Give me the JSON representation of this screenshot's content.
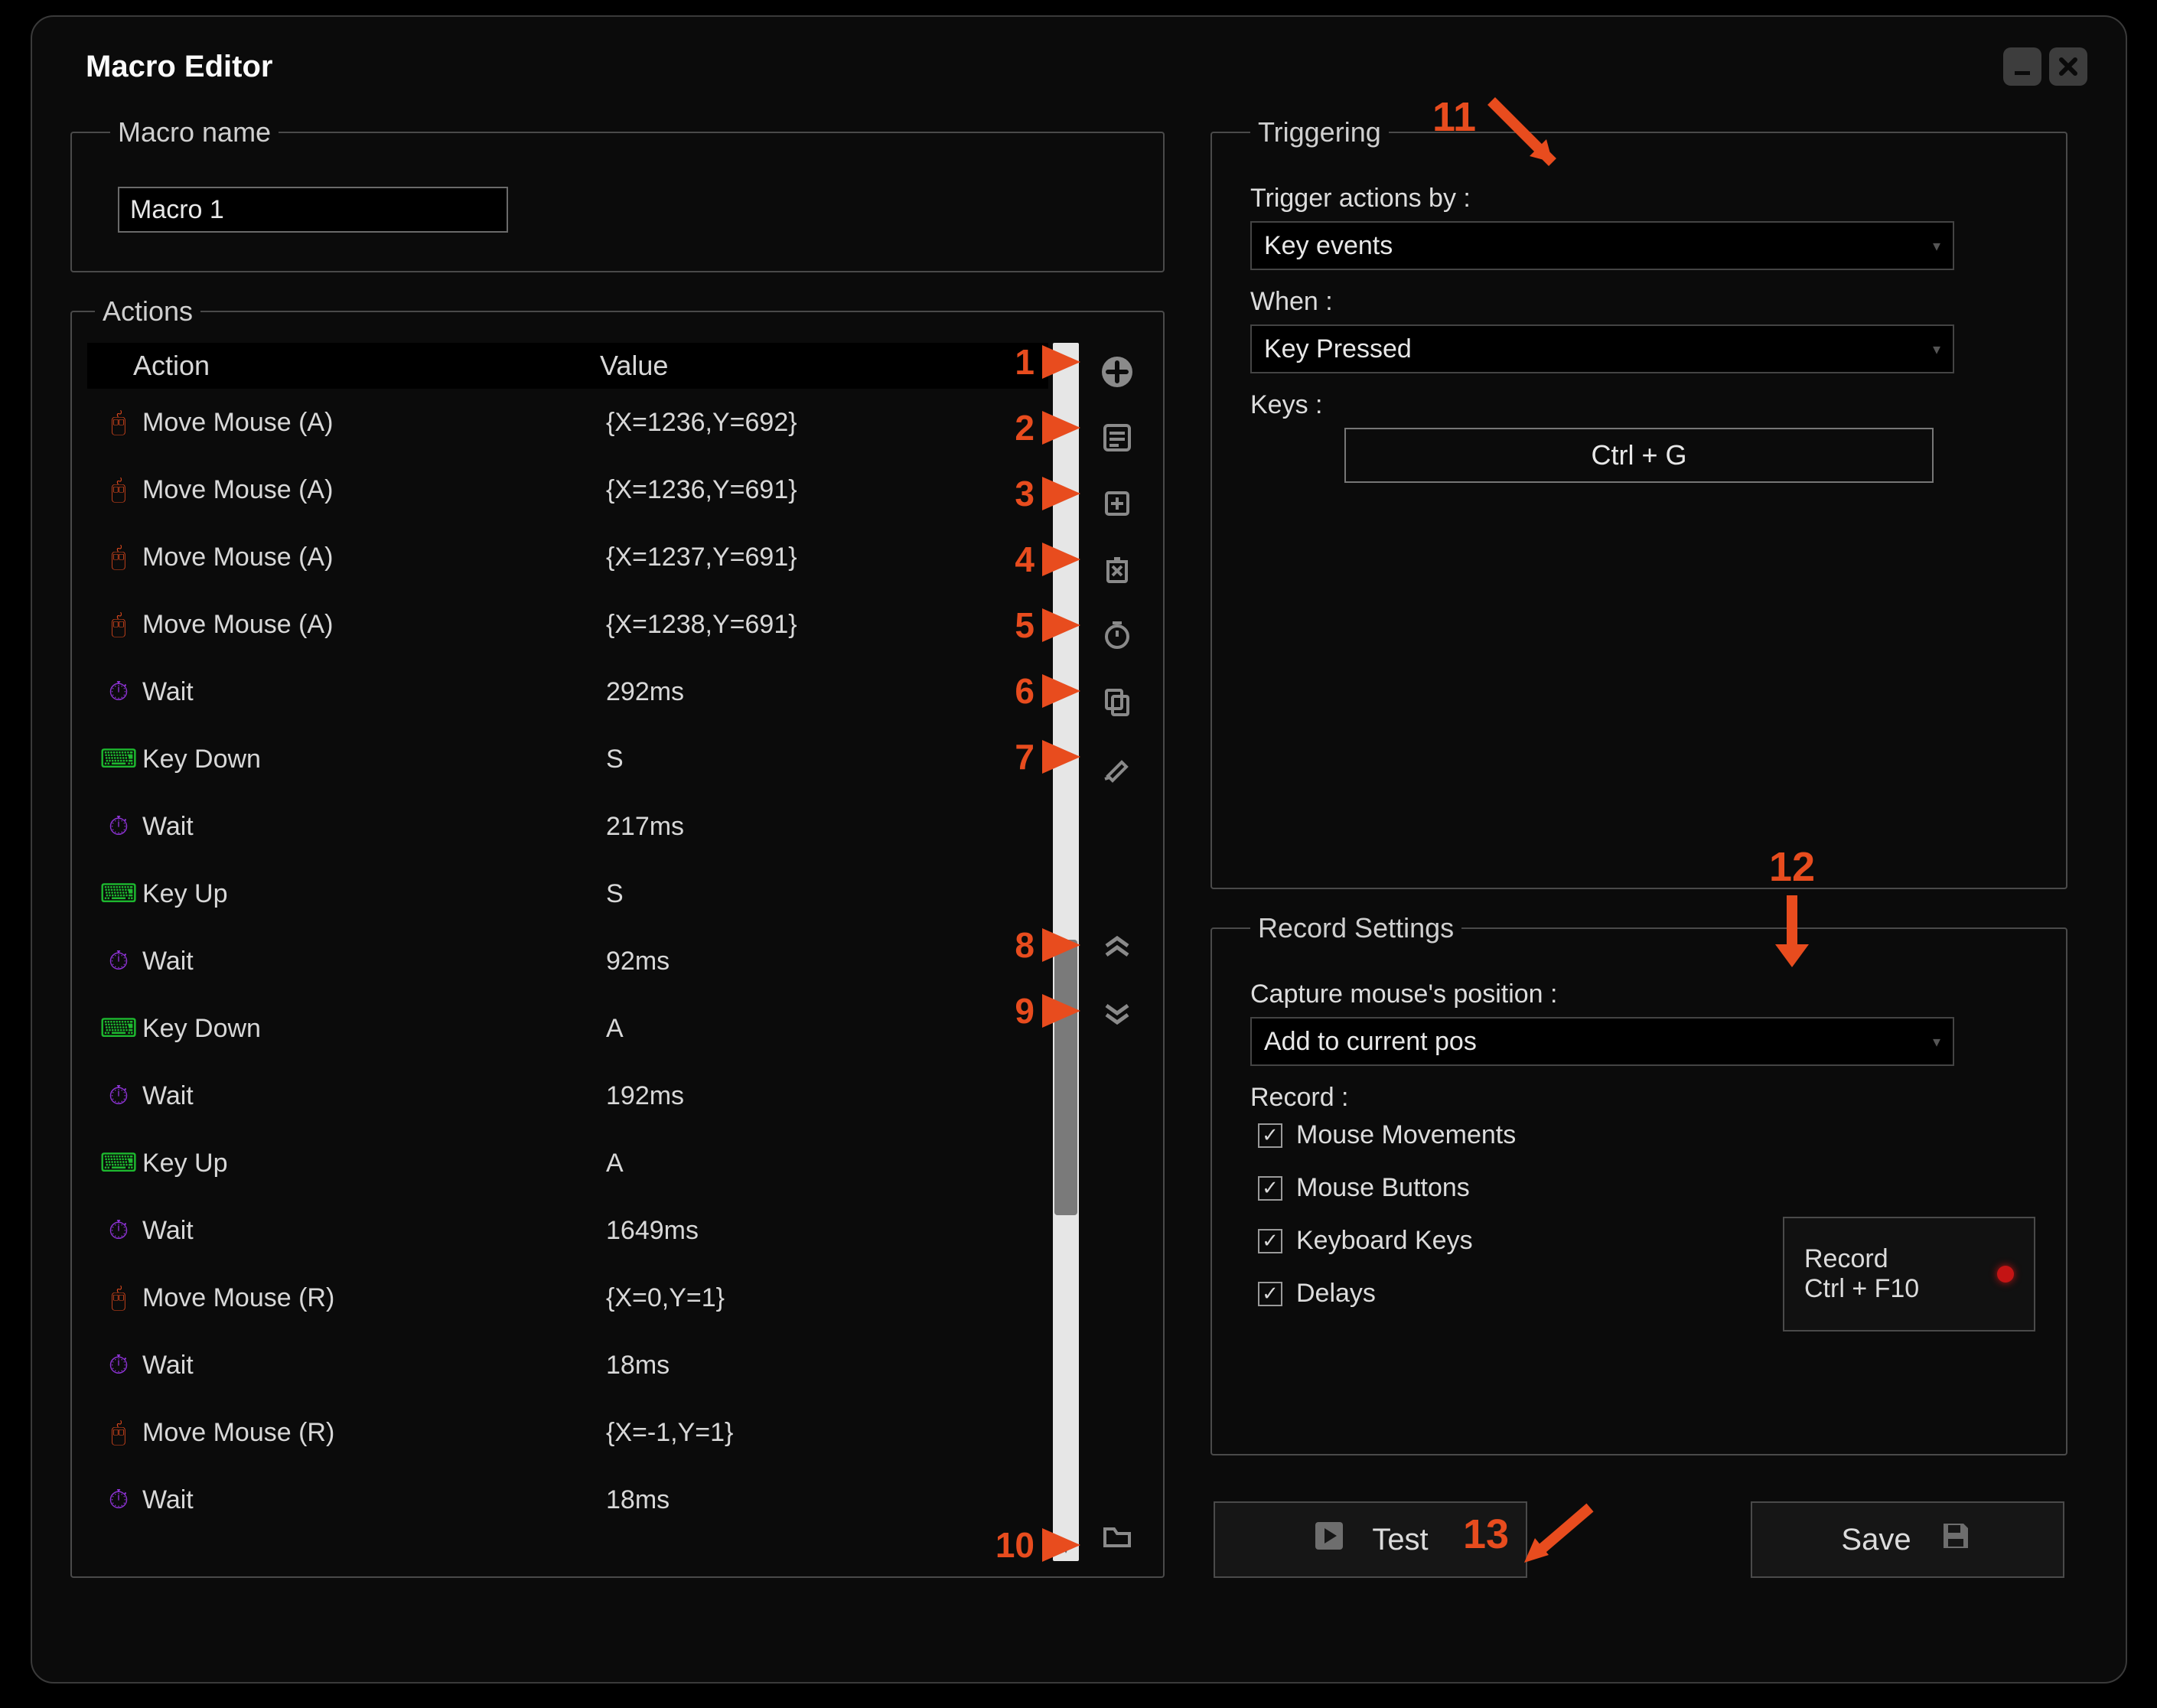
{
  "window": {
    "title": "Macro Editor"
  },
  "macro_name": {
    "legend": "Macro name",
    "value": "Macro 1"
  },
  "actions": {
    "legend": "Actions",
    "columns": {
      "action": "Action",
      "value": "Value"
    },
    "rows": [
      {
        "type": "mouse",
        "label": "Move Mouse (A)",
        "value": "{X=1236,Y=692}"
      },
      {
        "type": "mouse",
        "label": "Move Mouse (A)",
        "value": "{X=1236,Y=691}"
      },
      {
        "type": "mouse",
        "label": "Move Mouse (A)",
        "value": "{X=1237,Y=691}"
      },
      {
        "type": "mouse",
        "label": "Move Mouse (A)",
        "value": "{X=1238,Y=691}"
      },
      {
        "type": "wait",
        "label": "Wait",
        "value": "292ms"
      },
      {
        "type": "key",
        "label": "Key Down",
        "value": "S"
      },
      {
        "type": "wait",
        "label": "Wait",
        "value": "217ms"
      },
      {
        "type": "key",
        "label": "Key Up",
        "value": "S"
      },
      {
        "type": "wait",
        "label": "Wait",
        "value": "92ms"
      },
      {
        "type": "key",
        "label": "Key Down",
        "value": "A"
      },
      {
        "type": "wait",
        "label": "Wait",
        "value": "192ms"
      },
      {
        "type": "key",
        "label": "Key Up",
        "value": "A"
      },
      {
        "type": "wait",
        "label": "Wait",
        "value": "1649ms"
      },
      {
        "type": "mouse",
        "label": "Move Mouse (R)",
        "value": "{X=0,Y=1}"
      },
      {
        "type": "wait",
        "label": "Wait",
        "value": "18ms"
      },
      {
        "type": "mouse",
        "label": "Move Mouse (R)",
        "value": "{X=-1,Y=1}"
      },
      {
        "type": "wait",
        "label": "Wait",
        "value": "18ms"
      }
    ]
  },
  "toolbar_numbers": [
    "1",
    "2",
    "3",
    "4",
    "5",
    "6",
    "7",
    "8",
    "9",
    "10"
  ],
  "triggering": {
    "legend": "Triggering",
    "trigger_by_label": "Trigger actions by :",
    "trigger_by_value": "Key events",
    "when_label": "When :",
    "when_value": "Key Pressed",
    "keys_label": "Keys :",
    "keys_value": "Ctrl + G"
  },
  "record_settings": {
    "legend": "Record Settings",
    "capture_label": "Capture mouse's position :",
    "capture_value": "Add to current pos",
    "record_label": "Record :",
    "checks": {
      "mouse_movements": "Mouse Movements",
      "mouse_buttons": "Mouse Buttons",
      "keyboard_keys": "Keyboard Keys",
      "delays": "Delays"
    },
    "record_button": {
      "line1": "Record",
      "line2": "Ctrl + F10"
    }
  },
  "buttons": {
    "test": "Test",
    "save": "Save"
  },
  "callouts": {
    "n11": "11",
    "n12": "12",
    "n13": "13"
  }
}
